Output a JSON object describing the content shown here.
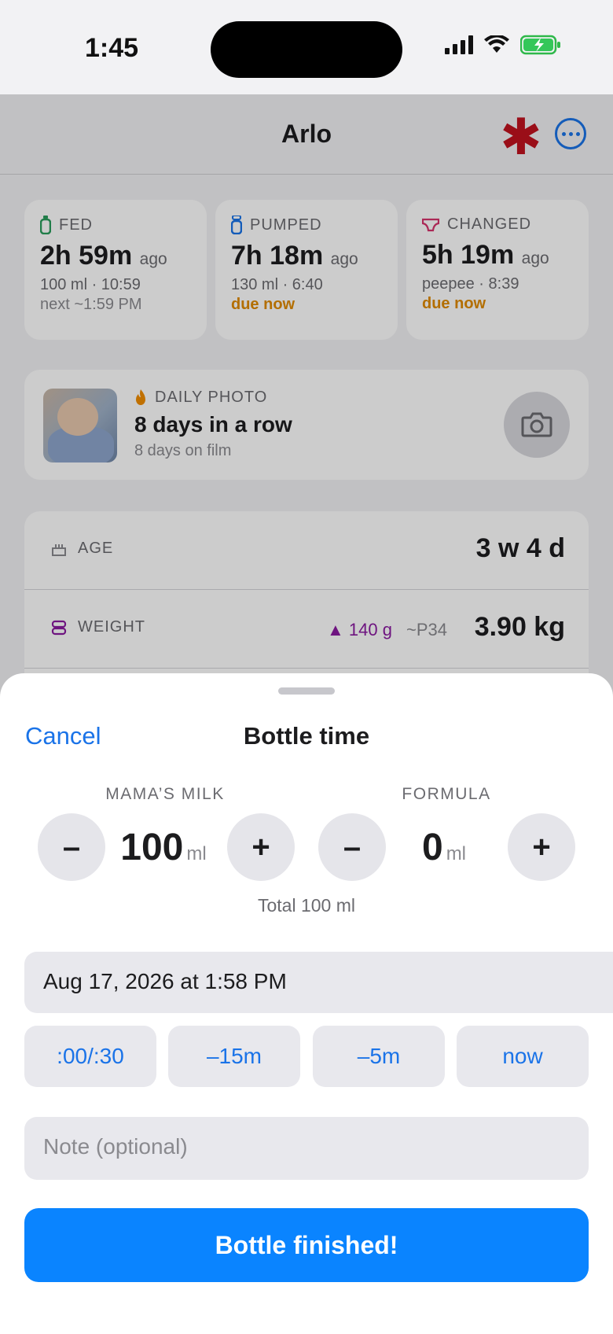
{
  "status_bar": {
    "time": "1:45"
  },
  "nav": {
    "title": "Arlo"
  },
  "stats": [
    {
      "label": "FED",
      "value": "2h 59m",
      "suffix": "ago",
      "detail": "100 ml · 10:59",
      "extra": "next ~1:59 PM"
    },
    {
      "label": "PUMPED",
      "value": "7h 18m",
      "suffix": "ago",
      "detail": "130 ml · 6:40",
      "extra": "due now"
    },
    {
      "label": "CHANGED",
      "value": "5h 19m",
      "suffix": "ago",
      "detail": "peepee · 8:39",
      "extra": "due now"
    }
  ],
  "daily_photo": {
    "label": "DAILY PHOTO",
    "streak": "8 days in a row",
    "sub": "8 days on film"
  },
  "age": {
    "label": "AGE",
    "value": "3 w 4 d"
  },
  "weight": {
    "label": "WEIGHT",
    "delta": "▲ 140 g",
    "percentile": "~P34",
    "value": "3.90 kg"
  },
  "sheet": {
    "cancel": "Cancel",
    "title": "Bottle time",
    "mama_label": "MAMA’S MILK",
    "mama_value": "100",
    "formula_label": "FORMULA",
    "formula_value": "0",
    "unit": "ml",
    "minus": "–",
    "plus": "+",
    "total": "Total 100 ml",
    "datetime": "Aug 17, 2026 at 1:58 PM",
    "quick": [
      ":00/:30",
      "–15m",
      "–5m",
      "now"
    ],
    "note_placeholder": "Note (optional)",
    "finish": "Bottle finished!"
  },
  "colors": {
    "accent": "#1a73e8",
    "button": "#0a84ff",
    "warning": "#e08a00",
    "weight": "#8a1aa0"
  }
}
